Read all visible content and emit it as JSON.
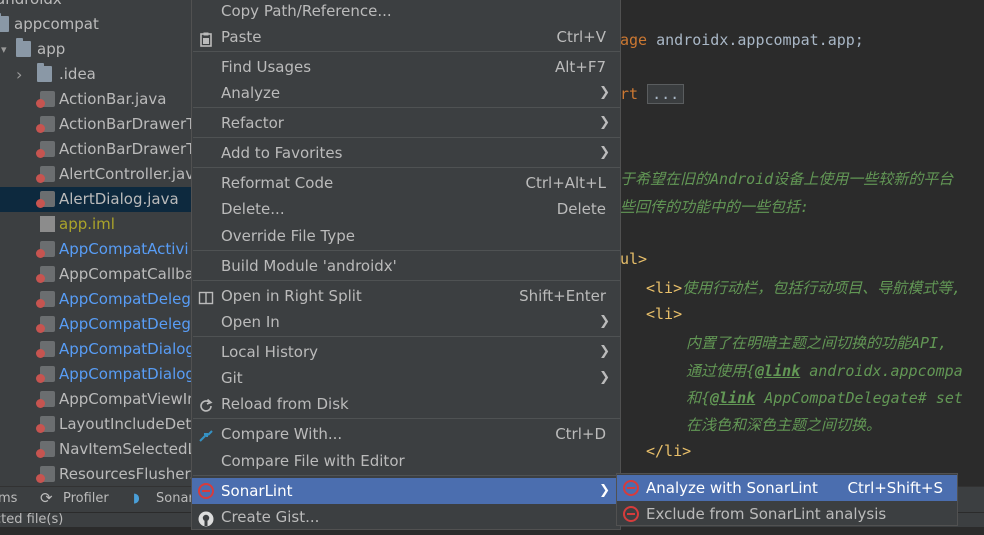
{
  "project_tree": {
    "rows": [
      {
        "label": "androidx",
        "type": "folder",
        "arrow": "",
        "indent": 0
      },
      {
        "label": "appcompat",
        "type": "module",
        "arrow": "",
        "indent": 0
      },
      {
        "label": "app",
        "type": "folder",
        "arrow": "▾",
        "indent": 1
      },
      {
        "label": ".idea",
        "type": "folder",
        "arrow": "›",
        "indent": 2
      },
      {
        "label": "ActionBar.java",
        "type": "java",
        "indent": 3
      },
      {
        "label": "ActionBarDrawerT",
        "type": "java",
        "indent": 3
      },
      {
        "label": "ActionBarDrawerT",
        "type": "java",
        "indent": 3
      },
      {
        "label": "AlertController.jav",
        "type": "java",
        "indent": 3
      },
      {
        "label": "AlertDialog.java",
        "type": "java",
        "indent": 3,
        "selected": true
      },
      {
        "label": "app.iml",
        "type": "iml",
        "indent": 3,
        "color": "olive"
      },
      {
        "label": "AppCompatActivi",
        "type": "java",
        "indent": 3,
        "color": "blue"
      },
      {
        "label": "AppCompatCallba",
        "type": "java",
        "indent": 3
      },
      {
        "label": "AppCompatDelege",
        "type": "java",
        "indent": 3,
        "color": "blue"
      },
      {
        "label": "AppCompatDelege",
        "type": "java",
        "indent": 3,
        "color": "blue"
      },
      {
        "label": "AppCompatDialog",
        "type": "java",
        "indent": 3,
        "color": "blue"
      },
      {
        "label": "AppCompatDialog",
        "type": "java",
        "indent": 3,
        "color": "blue"
      },
      {
        "label": "AppCompatViewIn",
        "type": "java",
        "indent": 3
      },
      {
        "label": "LayoutIncludeDete",
        "type": "java",
        "indent": 3
      },
      {
        "label": "NavItemSelectedL",
        "type": "java",
        "indent": 3
      },
      {
        "label": "ResourcesFlusher.",
        "type": "java",
        "indent": 3
      }
    ]
  },
  "bottom_tabs": {
    "problems": "ms",
    "profiler": "Profiler",
    "sonar": "Sonar"
  },
  "status_text": "cted file(s)",
  "editor": {
    "l1_kw": "age",
    "l1_plain": " androidx.appcompat.app;",
    "l2_kw": "rt",
    "l2_fold": "...",
    "l3": "于希望在旧的Android设备上使用一些较新的平台",
    "l4": "些回传的功能中的一些包括:",
    "l5": "ul>",
    "l6_tag": "<li>",
    "l6_text": "使用行动栏，包括行动项目、导航模式等,",
    "l7_tag": "<li>",
    "l8": "内置了在明暗主题之间切换的功能API,",
    "l9_pre": "通过使用{",
    "l9_link": "@link",
    "l9_post": " androidx.appcompa",
    "l10_pre": "和{",
    "l10_link": "@link",
    "l10_post": " AppCompatDelegate# set",
    "l11": "在浅色和深色主题之间切换。",
    "l12_tag": "</li>"
  },
  "context_menu": {
    "copy_path": "Copy Path/Reference...",
    "paste": "Paste",
    "paste_sc": "Ctrl+V",
    "find_usages": "Find Usages",
    "find_usages_sc": "Alt+F7",
    "analyze": "Analyze",
    "refactor": "Refactor",
    "add_favorites": "Add to Favorites",
    "reformat": "Reformat Code",
    "reformat_sc": "Ctrl+Alt+L",
    "delete": "Delete...",
    "delete_sc": "Delete",
    "override_type": "Override File Type",
    "build_module": "Build Module 'androidx'",
    "open_right": "Open in Right Split",
    "open_right_sc": "Shift+Enter",
    "open_in": "Open In",
    "local_history": "Local History",
    "git": "Git",
    "reload": "Reload from Disk",
    "compare_with": "Compare With...",
    "compare_with_sc": "Ctrl+D",
    "compare_editor": "Compare File with Editor",
    "sonarlint": "SonarLint",
    "create_gist": "Create Gist..."
  },
  "sonar_submenu": {
    "analyze": "Analyze with SonarLint",
    "analyze_sc": "Ctrl+Shift+S",
    "exclude": "Exclude from SonarLint analysis"
  },
  "colors": {
    "selection": "#4b6eaf",
    "menu_bg": "#3c3f41",
    "editor_bg": "#2b2b2b",
    "sonar_red": "#d63c3c"
  }
}
